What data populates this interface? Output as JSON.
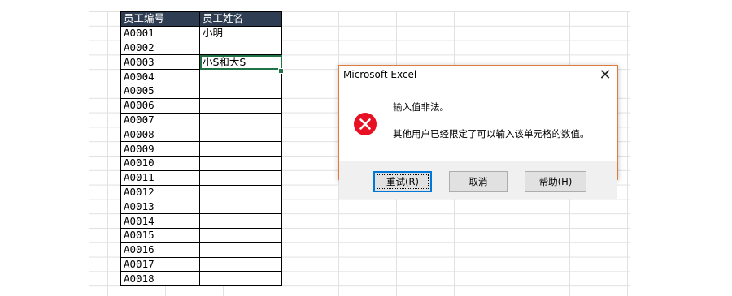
{
  "sheet": {
    "headers": [
      "员工编号",
      "员工姓名"
    ],
    "rows": [
      [
        "A0001",
        "小明"
      ],
      [
        "A0002",
        ""
      ],
      [
        "A0003",
        "小S和大S"
      ],
      [
        "A0004",
        ""
      ],
      [
        "A0005",
        ""
      ],
      [
        "A0006",
        ""
      ],
      [
        "A0007",
        ""
      ],
      [
        "A0008",
        ""
      ],
      [
        "A0009",
        ""
      ],
      [
        "A0010",
        ""
      ],
      [
        "A0011",
        ""
      ],
      [
        "A0012",
        ""
      ],
      [
        "A0013",
        ""
      ],
      [
        "A0014",
        ""
      ],
      [
        "A0015",
        ""
      ],
      [
        "A0016",
        ""
      ],
      [
        "A0017",
        ""
      ],
      [
        "A0018",
        ""
      ]
    ],
    "selected_cell_value": "小S和大S",
    "header_color": "#2f3d52",
    "selection_color": "#217346"
  },
  "dialog": {
    "title": "Microsoft Excel",
    "close_label": "✕",
    "icon": "error-icon",
    "message_line1": "输入值非法。",
    "message_line2": "其他用户已经限定了可以输入该单元格的数值。",
    "buttons": {
      "retry": "重试(R)",
      "cancel": "取消",
      "help": "帮助(H)"
    },
    "error_color": "#e81123",
    "border_color": "#e07b3b"
  }
}
